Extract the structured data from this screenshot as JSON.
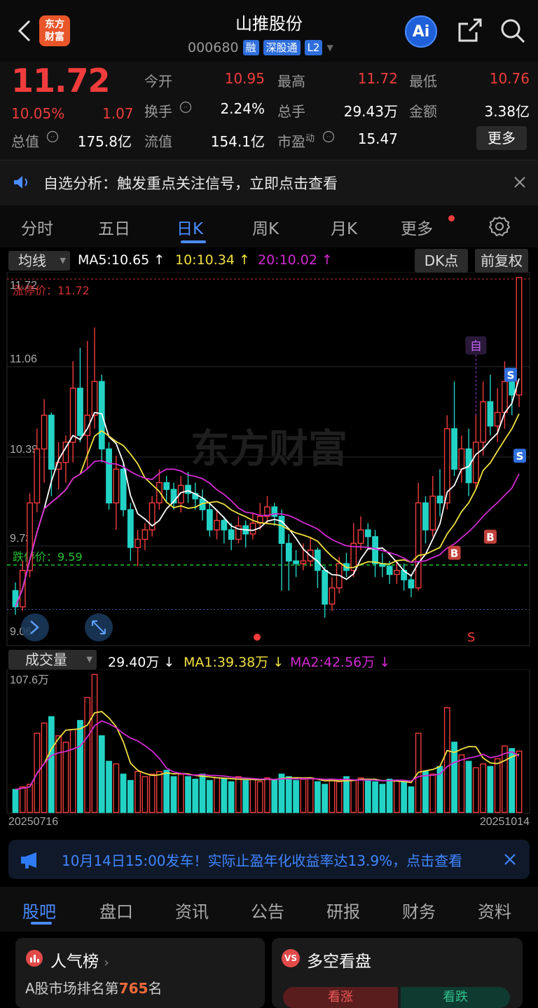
{
  "header": {
    "title": "山推股份",
    "code": "000680",
    "badges": [
      "融",
      "深股通",
      "L2"
    ],
    "logo": "东方\n财富",
    "ai_label": "Ai"
  },
  "quote": {
    "price": "11.72",
    "change_pct": "10.05%",
    "change_amt": "1.07",
    "rows": [
      [
        {
          "label": "今开",
          "value": "10.95",
          "color": "red"
        },
        {
          "label": "最高",
          "value": "11.72",
          "color": "red"
        },
        {
          "label": "最低",
          "value": "10.76",
          "color": "red"
        }
      ],
      [
        {
          "label": "换手",
          "value": "2.24%",
          "color": "white"
        },
        {
          "label": "总手",
          "value": "29.43万",
          "color": "white"
        },
        {
          "label": "金额",
          "value": "3.38亿",
          "color": "white"
        }
      ],
      [
        {
          "label": "总值",
          "value": "175.8亿",
          "color": "white"
        },
        {
          "label": "流值",
          "value": "154.1亿",
          "color": "white"
        },
        {
          "label": "市盈",
          "value": "15.47",
          "color": "white"
        }
      ]
    ],
    "pe_sup": "动",
    "more_label": "更多"
  },
  "banner": {
    "text": "自选分析：触发重点关注信号，立即点击查看"
  },
  "tabs": [
    "分时",
    "五日",
    "日K",
    "周K",
    "月K",
    "更多",
    ""
  ],
  "active_tab": 2,
  "indicator": {
    "ma_select": "均线",
    "ma5": "MA5:10.65",
    "ma10": "10:10.34",
    "ma20": "20:10.02",
    "dk_label": "DK点",
    "adjust_label": "前复权"
  },
  "chart_data": {
    "type": "candlestick",
    "y_ticks": [
      "11.72",
      "11.06",
      "10.39",
      "9.73",
      "9.06"
    ],
    "ylim": [
      9.06,
      11.72
    ],
    "limit_up_label": "涨停价：11.72",
    "limit_up": 11.72,
    "limit_down_label": "跌停价：9.59",
    "limit_down": 9.59,
    "watermark": "东方财富",
    "markers": {
      "zi": "自",
      "b": "B",
      "s": "S"
    },
    "bottom_s": "S",
    "candles": [
      [
        9.4,
        9.28,
        9.46,
        9.22
      ],
      [
        9.28,
        9.55,
        9.62,
        9.25
      ],
      [
        9.55,
        10.05,
        10.12,
        9.5
      ],
      [
        10.05,
        10.45,
        10.6,
        9.98
      ],
      [
        10.45,
        10.7,
        10.82,
        10.2
      ],
      [
        10.7,
        10.3,
        10.72,
        10.1
      ],
      [
        10.3,
        10.35,
        10.5,
        10.15
      ],
      [
        10.35,
        10.5,
        10.55,
        10.2
      ],
      [
        10.5,
        10.9,
        11.1,
        10.35
      ],
      [
        10.9,
        10.55,
        11.2,
        10.5
      ],
      [
        10.55,
        10.7,
        11.25,
        10.3
      ],
      [
        10.7,
        10.95,
        11.35,
        10.6
      ],
      [
        10.95,
        10.45,
        11.0,
        10.35
      ],
      [
        10.45,
        10.05,
        10.5,
        10.0
      ],
      [
        10.05,
        10.3,
        10.4,
        9.85
      ],
      [
        10.3,
        10.0,
        10.35,
        9.95
      ],
      [
        10.0,
        9.72,
        10.05,
        9.62
      ],
      [
        9.72,
        9.78,
        9.85,
        9.58
      ],
      [
        9.78,
        9.85,
        9.9,
        9.7
      ],
      [
        9.85,
        10.05,
        10.1,
        9.8
      ],
      [
        10.05,
        10.2,
        10.3,
        10.0
      ],
      [
        10.2,
        10.15,
        10.25,
        10.05
      ],
      [
        10.15,
        10.05,
        10.2,
        10.0
      ],
      [
        10.05,
        10.18,
        10.25,
        9.98
      ],
      [
        10.18,
        10.12,
        10.28,
        10.05
      ],
      [
        10.12,
        10.08,
        10.2,
        10.0
      ],
      [
        10.08,
        10.0,
        10.15,
        9.92
      ],
      [
        10.0,
        9.85,
        10.05,
        9.8
      ],
      [
        9.85,
        9.92,
        10.0,
        9.78
      ],
      [
        9.92,
        9.85,
        9.95,
        9.75
      ],
      [
        9.85,
        9.78,
        9.9,
        9.7
      ],
      [
        9.78,
        9.88,
        9.95,
        9.75
      ],
      [
        9.88,
        9.82,
        9.92,
        9.72
      ],
      [
        9.82,
        9.9,
        9.98,
        9.78
      ],
      [
        9.9,
        9.95,
        10.05,
        9.85
      ],
      [
        9.95,
        10.02,
        10.1,
        9.9
      ],
      [
        10.02,
        9.95,
        10.05,
        9.88
      ],
      [
        9.95,
        9.75,
        10.0,
        9.4
      ],
      [
        9.75,
        9.62,
        9.82,
        9.4
      ],
      [
        9.62,
        9.6,
        9.7,
        9.5
      ],
      [
        9.6,
        9.62,
        9.75,
        9.55
      ],
      [
        9.62,
        9.7,
        9.8,
        9.58
      ],
      [
        9.7,
        9.55,
        9.72,
        9.42
      ],
      [
        9.55,
        9.3,
        9.58,
        9.2
      ],
      [
        9.3,
        9.42,
        9.5,
        9.25
      ],
      [
        9.42,
        9.6,
        9.65,
        9.38
      ],
      [
        9.6,
        9.55,
        9.68,
        9.5
      ],
      [
        9.55,
        9.75,
        9.9,
        9.5
      ],
      [
        9.75,
        9.85,
        9.95,
        9.7
      ],
      [
        9.85,
        9.8,
        9.9,
        9.72
      ],
      [
        9.8,
        9.6,
        9.85,
        9.5
      ],
      [
        9.6,
        9.58,
        9.68,
        9.5
      ],
      [
        9.58,
        9.52,
        9.62,
        9.45
      ],
      [
        9.52,
        9.55,
        9.62,
        9.45
      ],
      [
        9.55,
        9.48,
        9.6,
        9.4
      ],
      [
        9.48,
        9.42,
        9.52,
        9.35
      ],
      [
        9.42,
        10.05,
        10.2,
        9.4
      ],
      [
        10.05,
        9.85,
        10.1,
        9.75
      ],
      [
        9.85,
        10.1,
        10.25,
        9.8
      ],
      [
        10.1,
        10.05,
        10.3,
        9.95
      ],
      [
        10.05,
        10.6,
        10.7,
        10.0
      ],
      [
        10.6,
        10.3,
        10.95,
        10.25
      ],
      [
        10.3,
        10.45,
        10.55,
        10.2
      ],
      [
        10.45,
        10.2,
        10.6,
        10.1
      ],
      [
        10.2,
        10.5,
        10.7,
        10.15
      ],
      [
        10.5,
        10.8,
        10.95,
        10.4
      ],
      [
        10.8,
        10.62,
        11.0,
        10.55
      ],
      [
        10.62,
        10.72,
        10.9,
        10.5
      ],
      [
        10.72,
        10.95,
        11.1,
        10.6
      ],
      [
        10.95,
        10.85,
        11.0,
        10.7
      ],
      [
        10.85,
        11.72,
        11.72,
        10.76
      ]
    ]
  },
  "volume": {
    "select": "成交量",
    "value": "29.40万",
    "ma1": "MA1:39.38万",
    "ma2": "MA2:42.56万",
    "top_label": "107.6万",
    "ylim": [
      0,
      107.6
    ],
    "start_date": "20250716",
    "end_date": "20251014",
    "bars": [
      18,
      20,
      22,
      62,
      70,
      75,
      60,
      55,
      65,
      72,
      90,
      108,
      60,
      40,
      38,
      30,
      25,
      32,
      28,
      30,
      32,
      33,
      28,
      30,
      28,
      26,
      30,
      25,
      27,
      26,
      24,
      28,
      25,
      26,
      24,
      27,
      26,
      30,
      28,
      25,
      26,
      27,
      24,
      22,
      26,
      24,
      28,
      25,
      27,
      26,
      24,
      22,
      26,
      25,
      24,
      20,
      62,
      32,
      30,
      36,
      82,
      55,
      45,
      40,
      35,
      38,
      36,
      42,
      52,
      50,
      48
    ]
  },
  "ad": {
    "text": "10月14日15:00发车！实际止盈年化收益率达13.9%，点击查看"
  },
  "bottom_tabs": [
    "股吧",
    "盘口",
    "资讯",
    "公告",
    "研报",
    "财务",
    "资料"
  ],
  "active_bottom_tab": 0,
  "cards": {
    "left_title": "人气榜",
    "left_sub_prefix": "A股市场排名第",
    "left_rank": "765",
    "left_sub_suffix": "名",
    "right_title": "多空看盘",
    "right_bull": "看涨",
    "right_bear": "看跌"
  },
  "colors": {
    "up": "#f03c3c",
    "down": "#22d3c5",
    "ma5": "#ffffff",
    "ma10": "#f0e040",
    "ma20": "#d22ad2",
    "accent": "#4a8cff"
  }
}
